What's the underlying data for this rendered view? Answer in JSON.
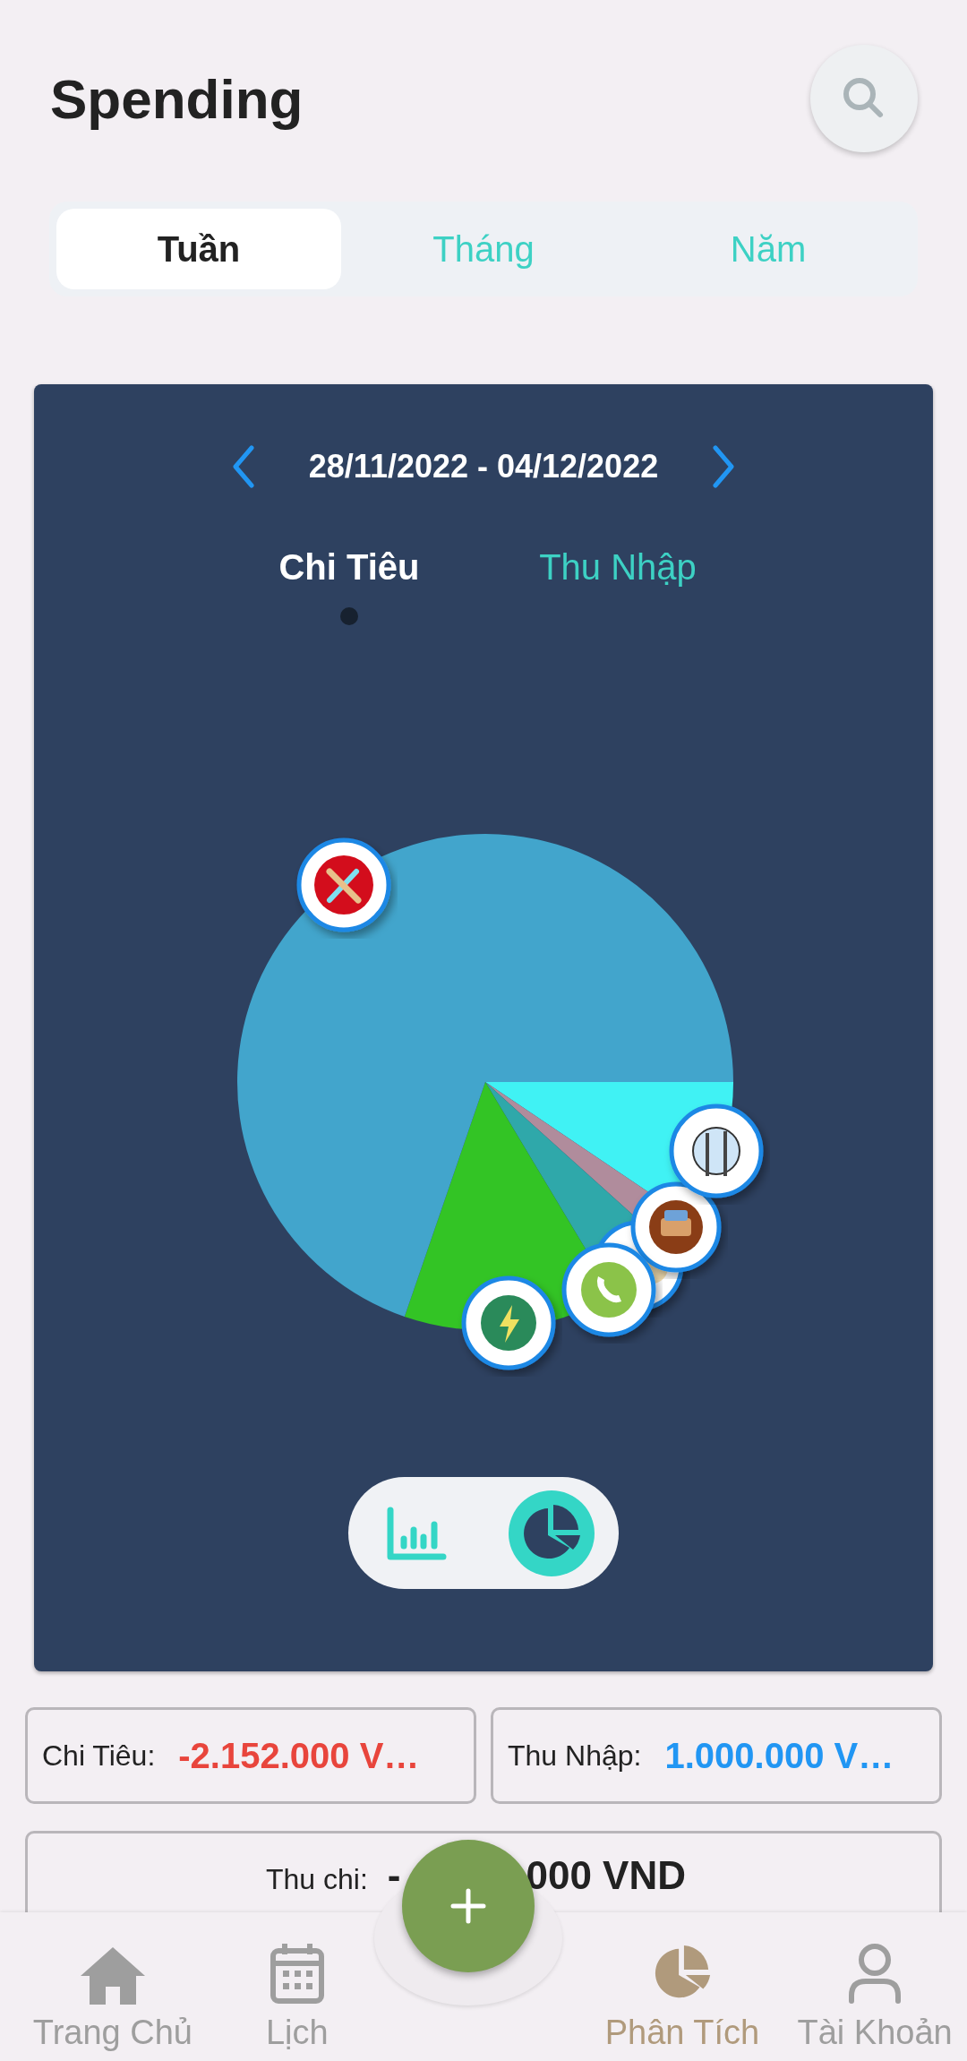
{
  "header": {
    "title": "Spending"
  },
  "period_tabs": [
    {
      "label": "Tuần",
      "selected": true
    },
    {
      "label": "Tháng",
      "selected": false
    },
    {
      "label": "Năm",
      "selected": false
    }
  ],
  "card": {
    "date_range": "28/11/2022 - 04/12/2022",
    "type_tabs": [
      {
        "label": "Chi Tiêu",
        "selected": true
      },
      {
        "label": "Thu Nhập",
        "selected": false
      }
    ],
    "view_toggle": [
      {
        "kind": "bar",
        "selected": false
      },
      {
        "kind": "pie",
        "selected": true
      }
    ]
  },
  "summary": [
    {
      "label": "Chi Tiêu:",
      "value": "-2.152.000 V…",
      "color": "#e8453c"
    },
    {
      "label": "Thu Nhập:",
      "value": "1.000.000 V…",
      "color": "#2196f3"
    }
  ],
  "balance": {
    "label": "Thu chi:",
    "value_start": "-",
    "value_end": "000 VND"
  },
  "nav": [
    {
      "label": "Trang Chủ",
      "kind": "home",
      "selected": false
    },
    {
      "label": "Lịch",
      "kind": "calendar",
      "selected": false
    },
    {
      "label": "Phân Tích",
      "kind": "analytics",
      "selected": true
    },
    {
      "label": "Tài Khoản",
      "kind": "account",
      "selected": false
    }
  ]
}
